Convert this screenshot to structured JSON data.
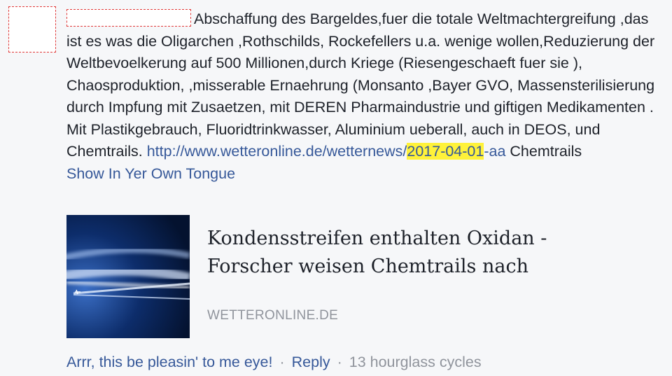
{
  "comment": {
    "text_main": "Abschaffung des Bargeldes,fuer die totale Weltmachtergreifung ,das ist es was die Oligarchen ,Rothschilds, Rockefellers u.a. wenige wollen,Reduzierung der Weltbevoelkerung auf 500 Millionen,durch Kriege (Riesengeschaeft fuer sie ), Chaosproduktion, ,misserable Ernaehrung (Monsanto ,Bayer GVO, Massensterilisierung durch Impfung mit Zusaetzen, mit DEREN Pharmaindustrie und giftigen Medikamenten . Mit Plastikgebrauch, Fluoridtrinkwasser, Aluminium ueberall, auch in DEOS, und Chemtrails.",
    "link_prefix": "http://www.wetteronline.de/wetternews/",
    "link_highlight": "2017-04-01",
    "link_suffix": "-aa",
    "trailing_text": " Chemtrails",
    "translate_label": "Show In Yer Own Tongue"
  },
  "card": {
    "title": "Kondensstreifen enthalten Oxidan - Forscher weisen Chemtrails nach",
    "domain": "WETTERONLINE.DE"
  },
  "actions": {
    "like_label": "Arrr, this be pleasin' to me eye!",
    "separator": "·",
    "reply_label": "Reply",
    "timestamp": "13 hourglass cycles"
  },
  "colors": {
    "link": "#365899",
    "highlight": "#fff23a",
    "muted": "#90949c",
    "background": "#f6f7f9"
  }
}
